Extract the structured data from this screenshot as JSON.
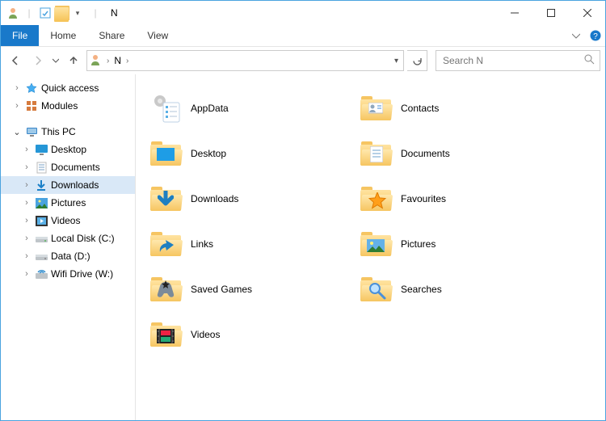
{
  "window": {
    "title": "N"
  },
  "ribbon": {
    "file": "File",
    "tabs": [
      "Home",
      "Share",
      "View"
    ]
  },
  "address": {
    "crumb_root": "N",
    "history_dropdown": "▾"
  },
  "search": {
    "placeholder": "Search N"
  },
  "sidebar": {
    "quick_access": "Quick access",
    "modules": "Modules",
    "this_pc": "This PC",
    "children": [
      {
        "label": "Desktop"
      },
      {
        "label": "Documents"
      },
      {
        "label": "Downloads",
        "selected": true
      },
      {
        "label": "Pictures"
      },
      {
        "label": "Videos"
      },
      {
        "label": "Local Disk (C:)"
      },
      {
        "label": "Data (D:)"
      },
      {
        "label": "Wifi Drive (W:)"
      }
    ]
  },
  "items": {
    "col1": [
      {
        "name": "AppData"
      },
      {
        "name": "Desktop"
      },
      {
        "name": "Downloads"
      },
      {
        "name": "Links"
      },
      {
        "name": "Saved Games"
      },
      {
        "name": "Videos"
      }
    ],
    "col2": [
      {
        "name": "Contacts"
      },
      {
        "name": "Documents"
      },
      {
        "name": "Favourites"
      },
      {
        "name": "Pictures"
      },
      {
        "name": "Searches"
      }
    ]
  }
}
